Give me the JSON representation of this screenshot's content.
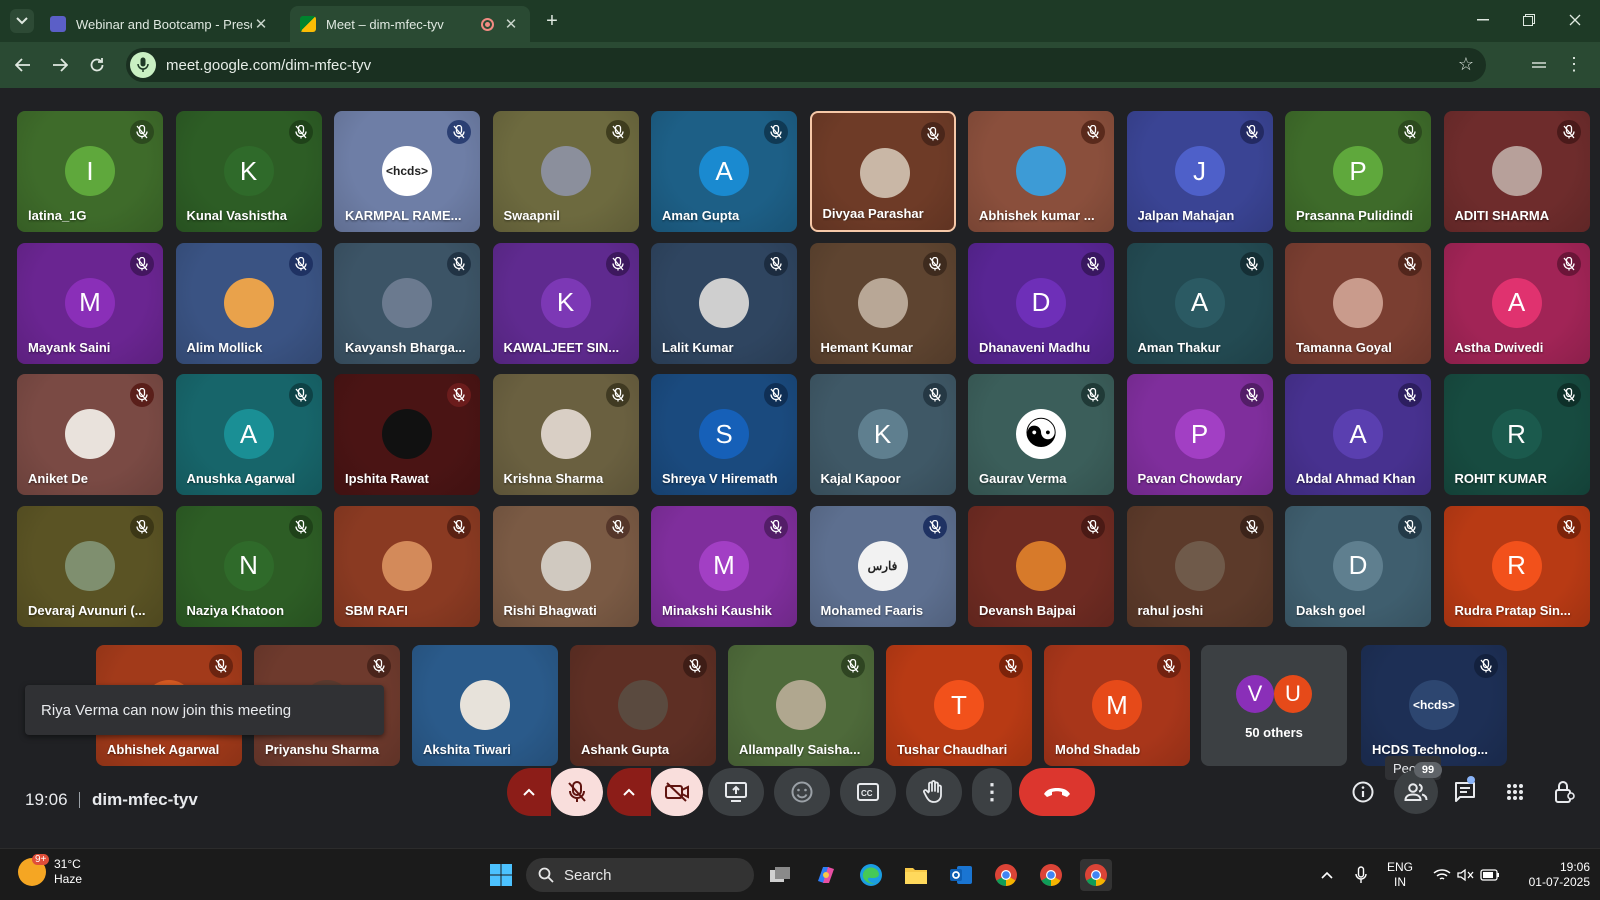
{
  "browser": {
    "tabs": [
      {
        "title": "Webinar and Bootcamp - Prese",
        "active": false
      },
      {
        "title": "Meet – dim-mfec-tyv",
        "active": true
      }
    ],
    "url": "meet.google.com/dim-mfec-tyv"
  },
  "tiles": [
    {
      "name": "latina_1G",
      "initial": "I",
      "avatar_color": "#5fa83c",
      "bg": "#3e6b2a",
      "mic_color": "#2c4a1e"
    },
    {
      "name": "Kunal Vashistha",
      "initial": "K",
      "avatar_color": "#2f6a2a",
      "bg": "#2d5d25",
      "mic_color": "#1f4219"
    },
    {
      "name": "KARMPAL RAME...",
      "initial": "<hcds>",
      "avatar_color": "#ffffff",
      "bg": "#6e7ea6",
      "mic_color": "#2b3f73"
    },
    {
      "name": "Swaapnil",
      "initial": "",
      "avatar_color": "#8b8f9c",
      "bg": "#6d6a3f",
      "mic_color": "#3f3d1e"
    },
    {
      "name": "Aman Gupta",
      "initial": "A",
      "avatar_color": "#1a8ad0",
      "bg": "#1d5f86",
      "mic_color": "#103a55"
    },
    {
      "name": "Divyaa Parashar",
      "initial": "",
      "avatar_color": "#c9b7a6",
      "bg": "#6e3b27",
      "mic_color": "#4a261a",
      "speaking": true
    },
    {
      "name": "Abhishek kumar ...",
      "initial": "",
      "avatar_color": "#3d9bd6",
      "bg": "#8a4f3c",
      "mic_color": "#5a2a1c"
    },
    {
      "name": "Jalpan Mahajan",
      "initial": "J",
      "avatar_color": "#4e60c9",
      "bg": "#3a4494",
      "mic_color": "#232a63"
    },
    {
      "name": "Prasanna Pulidindi",
      "initial": "P",
      "avatar_color": "#5fa83c",
      "bg": "#3e6b2a",
      "mic_color": "#2c4a1e"
    },
    {
      "name": "ADITI SHARMA",
      "initial": "",
      "avatar_color": "#b7a09a",
      "bg": "#6e2c2c",
      "mic_color": "#4a1a1a"
    },
    {
      "name": "Mayank Saini",
      "initial": "M",
      "avatar_color": "#8a2fb8",
      "bg": "#6a2591",
      "mic_color": "#441660"
    },
    {
      "name": "Alim Mollick",
      "initial": "",
      "avatar_color": "#e9a24b",
      "bg": "#3a5383",
      "mic_color": "#1f3263"
    },
    {
      "name": "Kavyansh Bharga...",
      "initial": "",
      "avatar_color": "#6b7a8f",
      "bg": "#3c5466",
      "mic_color": "#213344"
    },
    {
      "name": "KAWALJEET SIN...",
      "initial": "K",
      "avatar_color": "#7c38b5",
      "bg": "#5f2a8f",
      "mic_color": "#3d185e"
    },
    {
      "name": "Lalit Kumar",
      "initial": "",
      "avatar_color": "#cfcfcf",
      "bg": "#2f4560",
      "mic_color": "#1c2c40"
    },
    {
      "name": "Hemant Kumar",
      "initial": "",
      "avatar_color": "#b8a796",
      "bg": "#5e4430",
      "mic_color": "#3e2b1e"
    },
    {
      "name": "Dhanaveni Madhu",
      "initial": "D",
      "avatar_color": "#6e2fb8",
      "bg": "#582593",
      "mic_color": "#391760"
    },
    {
      "name": "Aman Thakur",
      "initial": "A",
      "avatar_color": "#2b5a63",
      "bg": "#234a52",
      "mic_color": "#152f35"
    },
    {
      "name": "Tamanna Goyal",
      "initial": "",
      "avatar_color": "#c99b8c",
      "bg": "#7a3e31",
      "mic_color": "#52261c"
    },
    {
      "name": "Astha Dwivedi",
      "initial": "A",
      "avatar_color": "#e0326f",
      "bg": "#a12456",
      "mic_color": "#6b1538"
    },
    {
      "name": "Aniket De",
      "initial": "",
      "avatar_color": "#e9e2dc",
      "bg": "#7a4a44",
      "mic_color": "#5a1f1a"
    },
    {
      "name": "Anushka Agarwal",
      "initial": "A",
      "avatar_color": "#1a8f95",
      "bg": "#17656a",
      "mic_color": "#0e4246"
    },
    {
      "name": "Ipshita Rawat",
      "initial": "",
      "avatar_color": "#111111",
      "bg": "#4a1414",
      "mic_color": "#6b1c1c"
    },
    {
      "name": "Krishna Sharma",
      "initial": "",
      "avatar_color": "#d9cfc5",
      "bg": "#6a6040",
      "mic_color": "#403a22"
    },
    {
      "name": "Shreya V Hiremath",
      "initial": "S",
      "avatar_color": "#1660b8",
      "bg": "#1a4a7e",
      "mic_color": "#0f2f55"
    },
    {
      "name": "Kajal Kapoor",
      "initial": "K",
      "avatar_color": "#5f7f8f",
      "bg": "#3f5866",
      "mic_color": "#253844"
    },
    {
      "name": "Gaurav Verma",
      "initial": "☯",
      "avatar_color": "#ffffff",
      "bg": "#3b5e5a",
      "mic_color": "#203a37"
    },
    {
      "name": "Pavan Chowdary",
      "initial": "P",
      "avatar_color": "#a23fc4",
      "bg": "#7f2e9c",
      "mic_color": "#531d68"
    },
    {
      "name": "Abdal Ahmad Khan",
      "initial": "A",
      "avatar_color": "#5a3fb0",
      "bg": "#47318f",
      "mic_color": "#2d1e60"
    },
    {
      "name": "ROHIT KUMAR",
      "initial": "R",
      "avatar_color": "#1b5a4d",
      "bg": "#174b40",
      "mic_color": "#0e3029"
    },
    {
      "name": "Devaraj Avunuri (...",
      "initial": "",
      "avatar_color": "#7f8f6f",
      "bg": "#5a5324",
      "mic_color": "#3c3716"
    },
    {
      "name": "Naziya Khatoon",
      "initial": "N",
      "avatar_color": "#2f6a2a",
      "bg": "#2d5d25",
      "mic_color": "#1f4219"
    },
    {
      "name": "SBM RAFI",
      "initial": "",
      "avatar_color": "#d38a5a",
      "bg": "#8a3a22",
      "mic_color": "#5a2113"
    },
    {
      "name": "Rishi Bhagwati",
      "initial": "",
      "avatar_color": "#d0c9c0",
      "bg": "#7a5a44",
      "mic_color": "#55362a"
    },
    {
      "name": "Minakshi Kaushik",
      "initial": "M",
      "avatar_color": "#a23fc4",
      "bg": "#7f2e9c",
      "mic_color": "#531d68"
    },
    {
      "name": "Mohamed Faaris",
      "initial": "فارس",
      "avatar_color": "#f2f2f2",
      "bg": "#5d6f8f",
      "mic_color": "#1f3263"
    },
    {
      "name": "Devansh Bajpai",
      "initial": "",
      "avatar_color": "#d77a2a",
      "bg": "#6e2b22",
      "mic_color": "#4a1a15"
    },
    {
      "name": "rahul joshi",
      "initial": "",
      "avatar_color": "#6f5a4a",
      "bg": "#5c3a2a",
      "mic_color": "#3c241a"
    },
    {
      "name": "Daksh goel",
      "initial": "D",
      "avatar_color": "#5f7f8f",
      "bg": "#3f5e6e",
      "mic_color": "#233a48"
    },
    {
      "name": "Rudra Pratap Sin...",
      "initial": "R",
      "avatar_color": "#f2511b",
      "bg": "#b83a14",
      "mic_color": "#7c230a"
    },
    {
      "name": "Abhishek Agarwal",
      "initial": "",
      "avatar_color": "#d45a22",
      "bg": "#a23a1a",
      "mic_color": "#6b2410"
    },
    {
      "name": "Priyanshu Sharma",
      "initial": "",
      "avatar_color": "#5a3a2f",
      "bg": "#6e3a2d",
      "mic_color": "#4a241b"
    },
    {
      "name": "Akshita Tiwari",
      "initial": "",
      "avatar_color": "#e7e2da",
      "bg": "#2a5a8a",
      "mic_color": ""
    },
    {
      "name": "Ashank Gupta",
      "initial": "",
      "avatar_color": "#5a4a3f",
      "bg": "#5e2f24",
      "mic_color": "#3e1d16"
    },
    {
      "name": "Allampally Saisha...",
      "initial": "",
      "avatar_color": "#b0a78f",
      "bg": "#4e6a3a",
      "mic_color": "#2f4522"
    },
    {
      "name": "Tushar Chaudhari",
      "initial": "T",
      "avatar_color": "#f2511b",
      "bg": "#b83a14",
      "mic_color": "#7c230a"
    },
    {
      "name": "Mohd Shadab",
      "initial": "M",
      "avatar_color": "#e64a19",
      "bg": "#a8361a",
      "mic_color": "#722210"
    },
    {
      "name": "HCDS Technolog...",
      "initial": "<hcds>",
      "avatar_color": "#2d4670",
      "bg": "#1d2f55",
      "mic_color": "#13213e"
    }
  ],
  "others": {
    "label": "50 others",
    "initials": [
      "V",
      "U"
    ],
    "colors": [
      "#8a2fb8",
      "#e64a19"
    ]
  },
  "toast": "Riya Verma can now join this meeting",
  "tooltip": "People",
  "meeting": {
    "time": "19:06",
    "code": "dim-mfec-tyv"
  },
  "people_count": "99",
  "taskbar": {
    "weather_temp": "31°C",
    "weather_desc": "Haze",
    "notif_badge": "9+",
    "search_placeholder": "Search",
    "lang_1": "ENG",
    "lang_2": "IN",
    "time": "19:06",
    "date": "01-07-2025"
  },
  "colors": {
    "end_call": "#dc362e",
    "mic_off": "#f9dedc",
    "accent": "#8ab4f8"
  }
}
